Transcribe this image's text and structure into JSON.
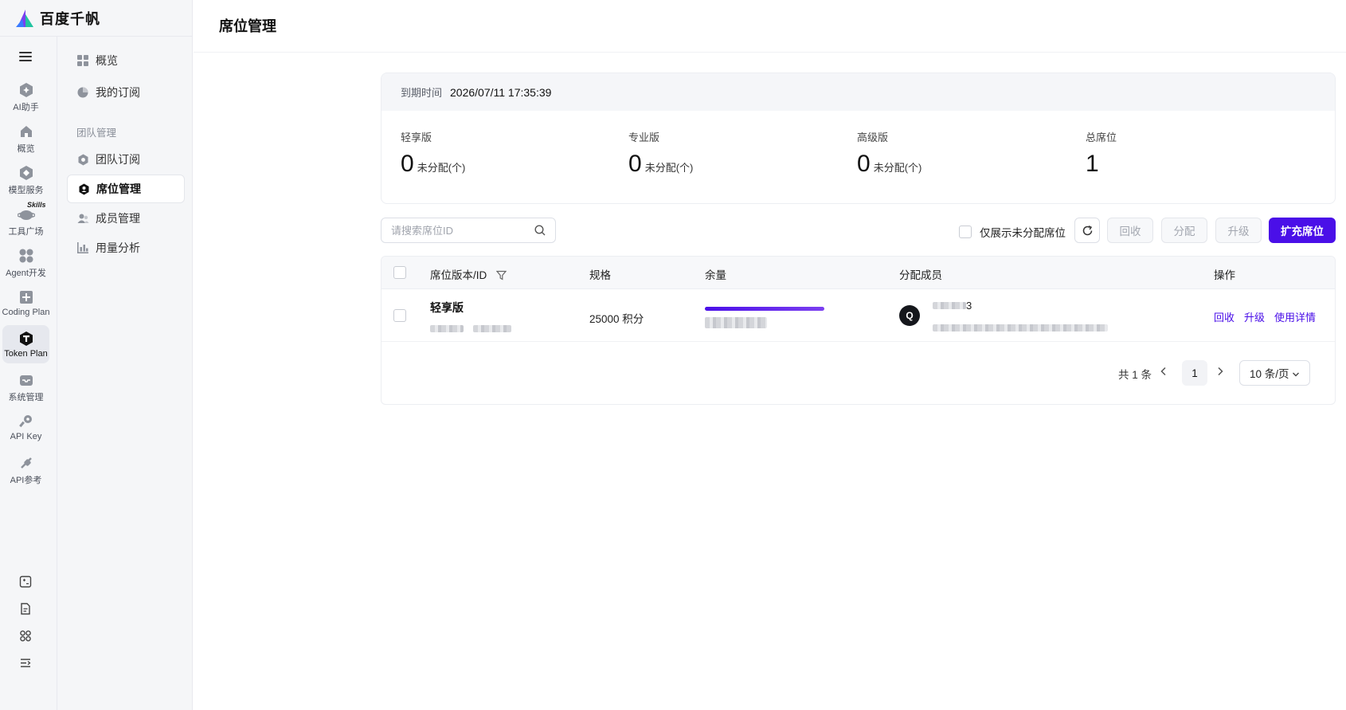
{
  "brand": {
    "name": "百度千帆"
  },
  "rail": {
    "items": [
      {
        "label": "AI助手",
        "icon": "ai-assistant-icon"
      },
      {
        "label": "概览",
        "icon": "home-icon"
      },
      {
        "label": "模型服务",
        "icon": "model-service-icon"
      },
      {
        "label": "工具广场",
        "icon": "tool-square-icon",
        "badge": "Skills"
      },
      {
        "label": "Agent开发",
        "icon": "agent-dev-icon"
      },
      {
        "label": "Coding Plan",
        "icon": "coding-plan-icon"
      },
      {
        "label": "Token Plan",
        "icon": "token-plan-icon"
      },
      {
        "label": "系统管理",
        "icon": "system-manage-icon"
      },
      {
        "label": "API Key",
        "icon": "key-icon"
      },
      {
        "label": "API参考",
        "icon": "api-reference-icon"
      }
    ]
  },
  "sidebar": {
    "items": [
      {
        "label": "概览"
      },
      {
        "label": "我的订阅"
      }
    ],
    "group_title": "团队管理",
    "group_items": [
      {
        "label": "团队订阅"
      },
      {
        "label": "席位管理"
      },
      {
        "label": "成员管理"
      },
      {
        "label": "用量分析"
      }
    ]
  },
  "page": {
    "title": "席位管理"
  },
  "summary": {
    "expiry_label": "到期时间",
    "expiry_value": "2026/07/11 17:35:39",
    "stats": [
      {
        "title": "轻享版",
        "value": "0",
        "unit": "未分配(个)"
      },
      {
        "title": "专业版",
        "value": "0",
        "unit": "未分配(个)"
      },
      {
        "title": "高级版",
        "value": "0",
        "unit": "未分配(个)"
      },
      {
        "title": "总席位",
        "value": "1",
        "unit": ""
      }
    ]
  },
  "toolbar": {
    "search_placeholder": "请搜索席位ID",
    "only_unassigned_label": "仅展示未分配席位",
    "recycle_label": "回收",
    "assign_label": "分配",
    "upgrade_label": "升级",
    "expand_label": "扩充席位"
  },
  "table": {
    "columns": {
      "seat": "席位版本/ID",
      "spec": "规格",
      "remaining": "余量",
      "member": "分配成员",
      "actions": "操作"
    },
    "rows": [
      {
        "seat_version": "轻享版",
        "spec": "25000 积分",
        "remaining_fraction": 1.0,
        "member_initial": "Q",
        "member_name_suffix": "3",
        "actions": [
          "回收",
          "升级",
          "使用详情"
        ]
      }
    ]
  },
  "pagination": {
    "total_text": "共 1 条",
    "current_page": "1",
    "page_size": "10 条/页"
  },
  "colors": {
    "accent": "#4a0fe8"
  }
}
